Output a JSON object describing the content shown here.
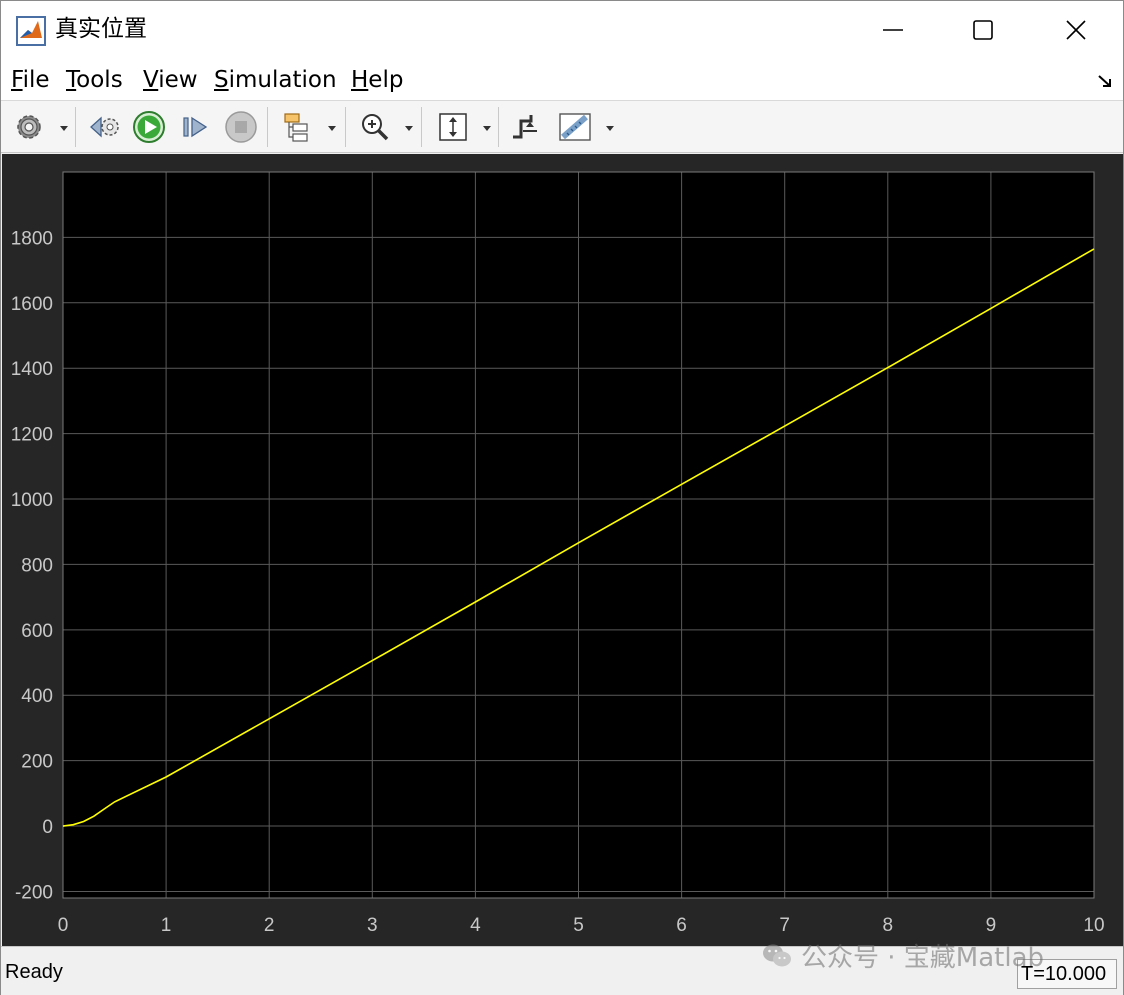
{
  "window": {
    "title": "真实位置"
  },
  "menu": {
    "items": [
      {
        "key": "F",
        "rest": "ile"
      },
      {
        "key": "T",
        "rest": "ools"
      },
      {
        "key": "V",
        "rest": "iew"
      },
      {
        "key": "S",
        "rest": "imulation"
      },
      {
        "key": "H",
        "rest": "elp"
      }
    ]
  },
  "toolbar": {
    "icons": [
      "gear-icon",
      "step-back-icon",
      "run-icon",
      "step-forward-icon",
      "stop-icon",
      "signal-hierarchy-icon",
      "zoom-icon",
      "scale-axes-icon",
      "triggers-icon",
      "measurements-icon"
    ]
  },
  "colors": {
    "plot_bg": "#000000",
    "frame_bg": "#262626",
    "grid": "#5a5a5a",
    "tick_text": "#c8c8c8",
    "line": "#ffff00"
  },
  "chart_data": {
    "type": "line",
    "title": "",
    "xlabel": "",
    "ylabel": "",
    "xlim": [
      0,
      10
    ],
    "ylim": [
      -220,
      2000
    ],
    "xticks": [
      0,
      1,
      2,
      3,
      4,
      5,
      6,
      7,
      8,
      9,
      10
    ],
    "yticks": [
      -200,
      0,
      200,
      400,
      600,
      800,
      1000,
      1200,
      1400,
      1600,
      1800
    ],
    "grid": true,
    "legend": "none",
    "series": [
      {
        "color": "#ffff00",
        "x": [
          0,
          0.1,
          0.2,
          0.3,
          0.4,
          0.5,
          1,
          2,
          3,
          4,
          5,
          6,
          7,
          8,
          9,
          10
        ],
        "y": [
          0,
          4,
          14,
          30,
          52,
          74,
          150,
          328,
          506,
          685,
          866,
          1045,
          1223,
          1402,
          1583,
          1765
        ]
      }
    ]
  },
  "status": {
    "state": "Ready",
    "time": "T=10.000"
  },
  "watermark": {
    "text": "公众号 · 宝藏Matlab"
  }
}
